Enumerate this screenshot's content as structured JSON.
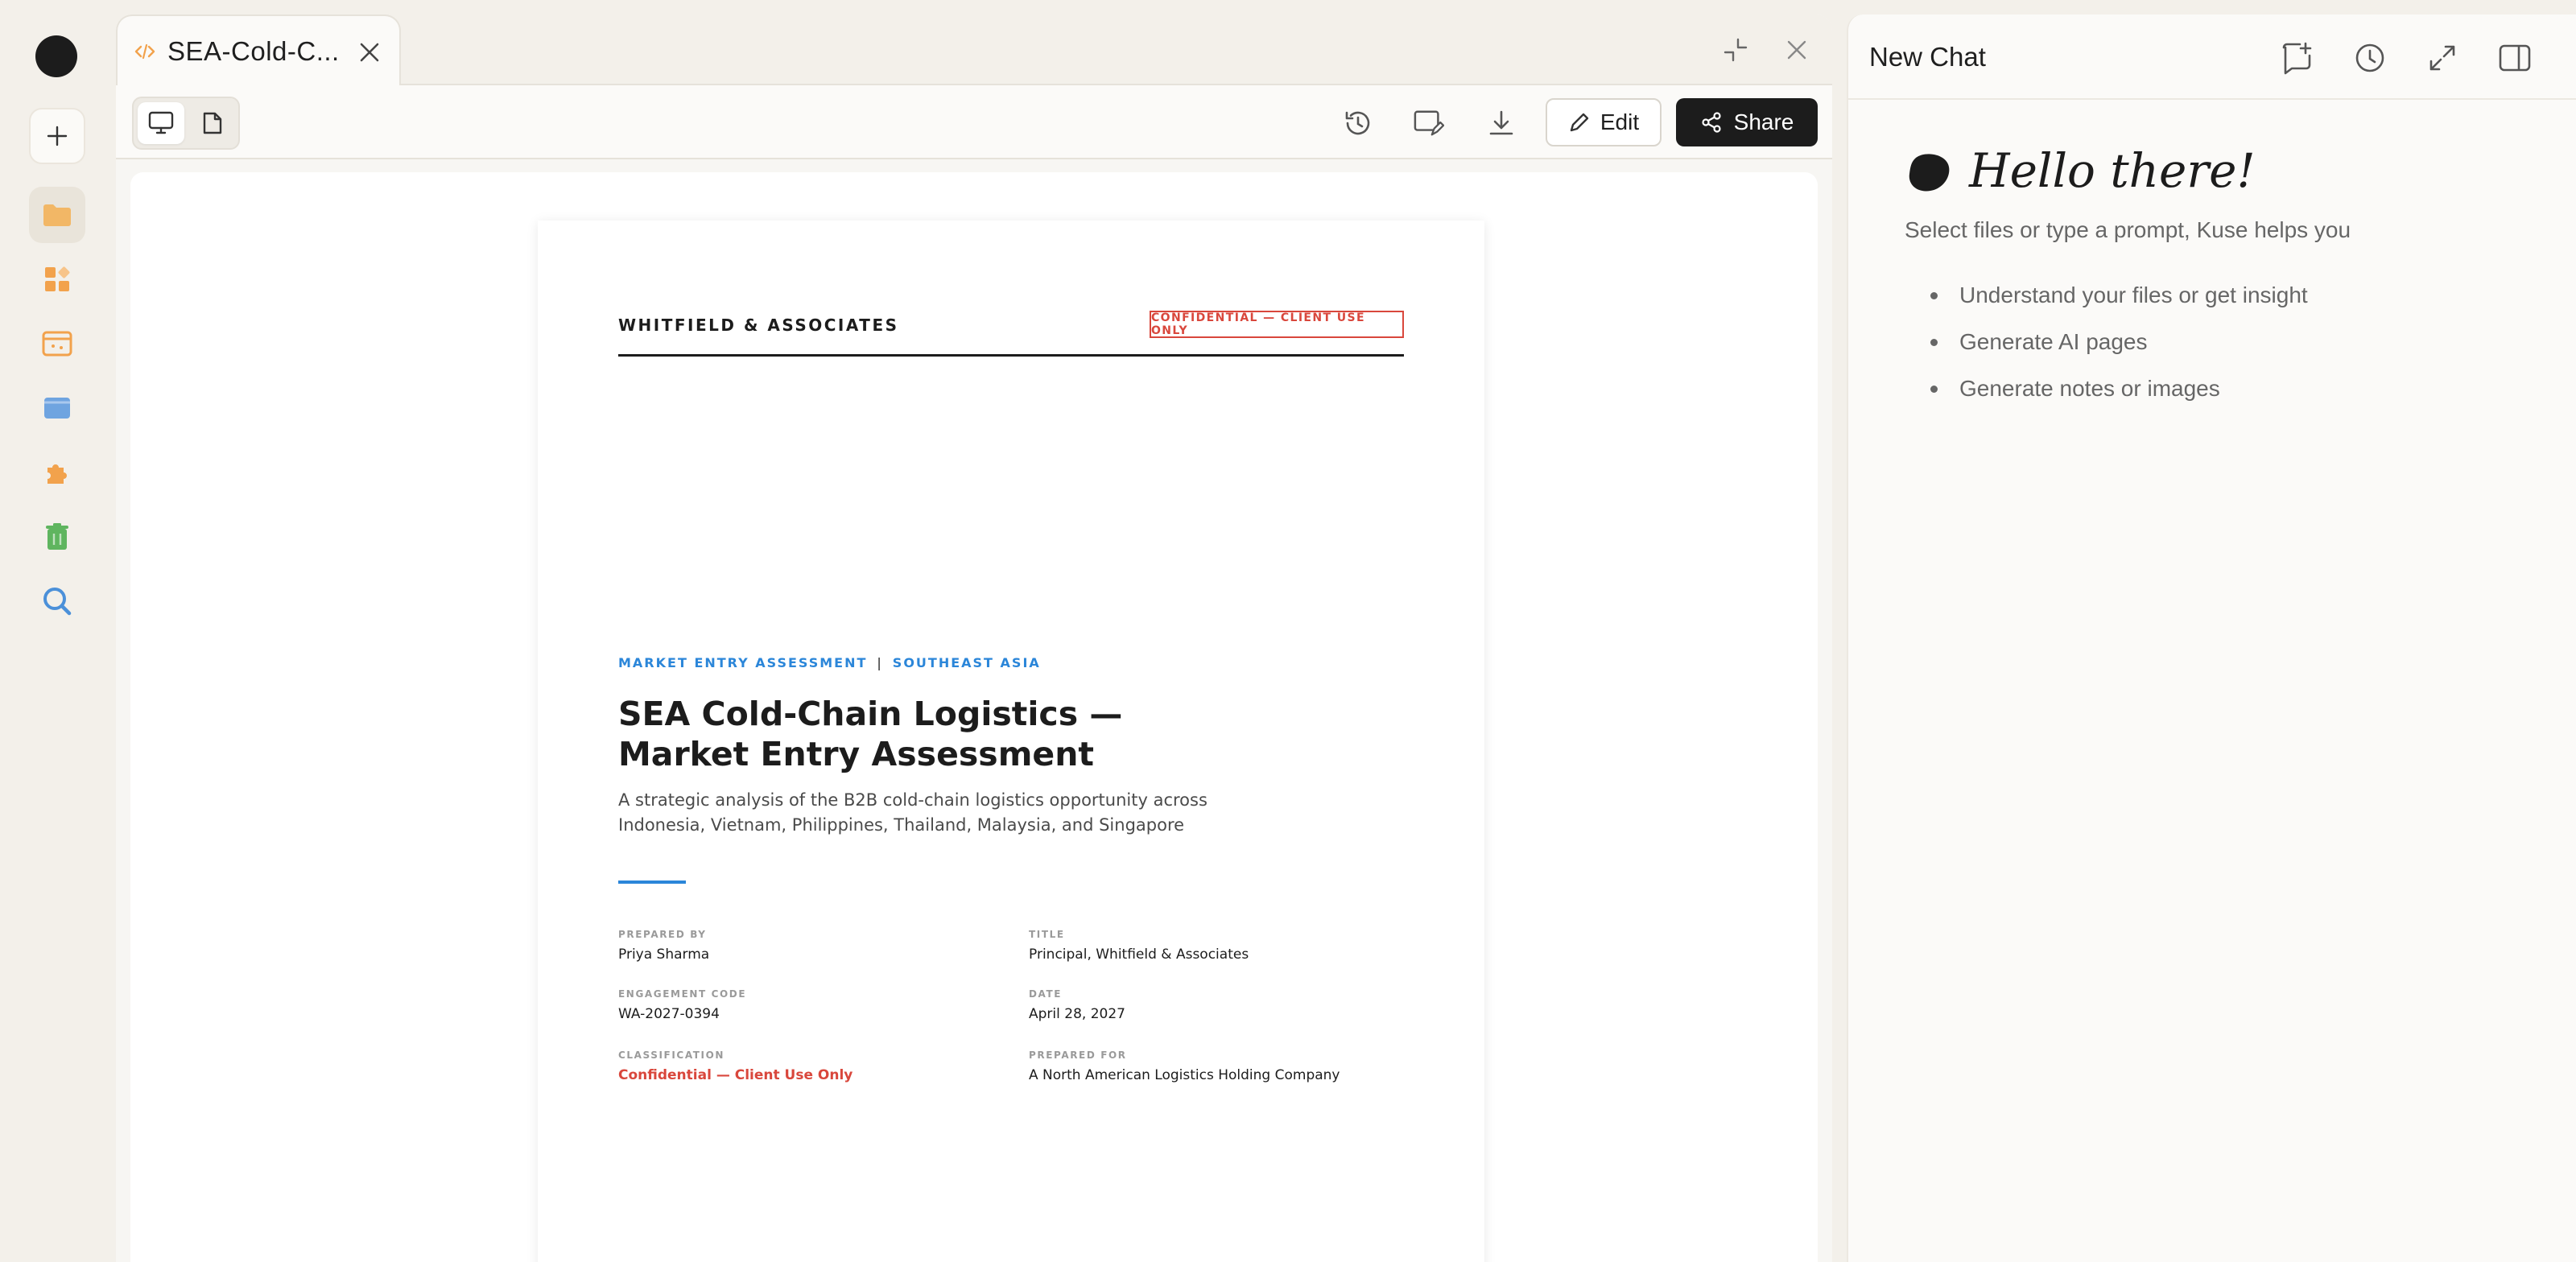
{
  "rail": {
    "items": [
      {
        "name": "folder-icon",
        "color": "#f2b766"
      },
      {
        "name": "apps-icon",
        "color": "#f2a24c"
      },
      {
        "name": "browser-window-icon",
        "color": "#f2a24c"
      },
      {
        "name": "panel-icon",
        "color": "#6fa4e0"
      },
      {
        "name": "puzzle-piece-icon",
        "color": "#f2a24c"
      },
      {
        "name": "trash-icon",
        "color": "#5fb55f"
      },
      {
        "name": "search-icon",
        "color": "#4b90d9"
      }
    ]
  },
  "tab": {
    "title": "SEA-Cold-C..."
  },
  "toolbar": {
    "edit_label": "Edit",
    "share_label": "Share"
  },
  "document": {
    "firm": "WHITFIELD & ASSOCIATES",
    "badge": "CONFIDENTIAL — CLIENT USE ONLY",
    "kicker_left": "MARKET ENTRY ASSESSMENT",
    "kicker_sep": "|",
    "kicker_right": "SOUTHEAST ASIA",
    "title_line1": "SEA Cold-Chain Logistics —",
    "title_line2": "Market Entry Assessment",
    "subtitle_line1": "A strategic analysis of the B2B cold-chain logistics opportunity across",
    "subtitle_line2": "Indonesia, Vietnam, Philippines, Thailand, Malaysia, and Singapore",
    "meta": {
      "prepared_by_label": "PREPARED BY",
      "prepared_by": "Priya Sharma",
      "title_label": "TITLE",
      "title": "Principal, Whitfield & Associates",
      "engagement_label": "ENGAGEMENT CODE",
      "engagement": "WA-2027-0394",
      "date_label": "DATE",
      "date": "April 28, 2027",
      "classification_label": "CLASSIFICATION",
      "classification": "Confidential — Client Use Only",
      "prepared_for_label": "PREPARED FOR",
      "prepared_for": "A North American Logistics Holding Company"
    }
  },
  "chat": {
    "title": "New Chat",
    "greeting": "Hello there!",
    "intro": "Select files or type a prompt, Kuse helps you",
    "bullets": [
      "Understand your files or get insight",
      "Generate AI pages",
      "Generate notes or images"
    ]
  },
  "colors": {
    "accent_blue": "#2b86d9",
    "confidential_red": "#d9473c",
    "share_bg": "#1c1c1c"
  }
}
